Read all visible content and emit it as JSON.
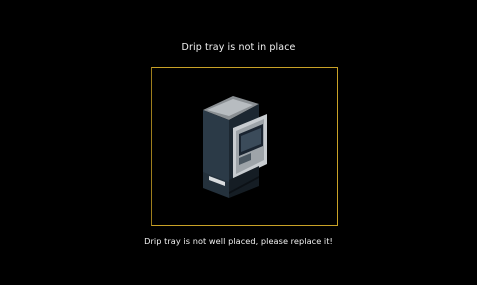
{
  "alert": {
    "title": "Drip tray is not in place",
    "message": "Drip tray is not well placed, please replace it!"
  },
  "image": {
    "icon": "coffee-machine-icon"
  },
  "colors": {
    "background": "#000000",
    "frame": "#c9a227",
    "text": "#f2f2f2"
  }
}
